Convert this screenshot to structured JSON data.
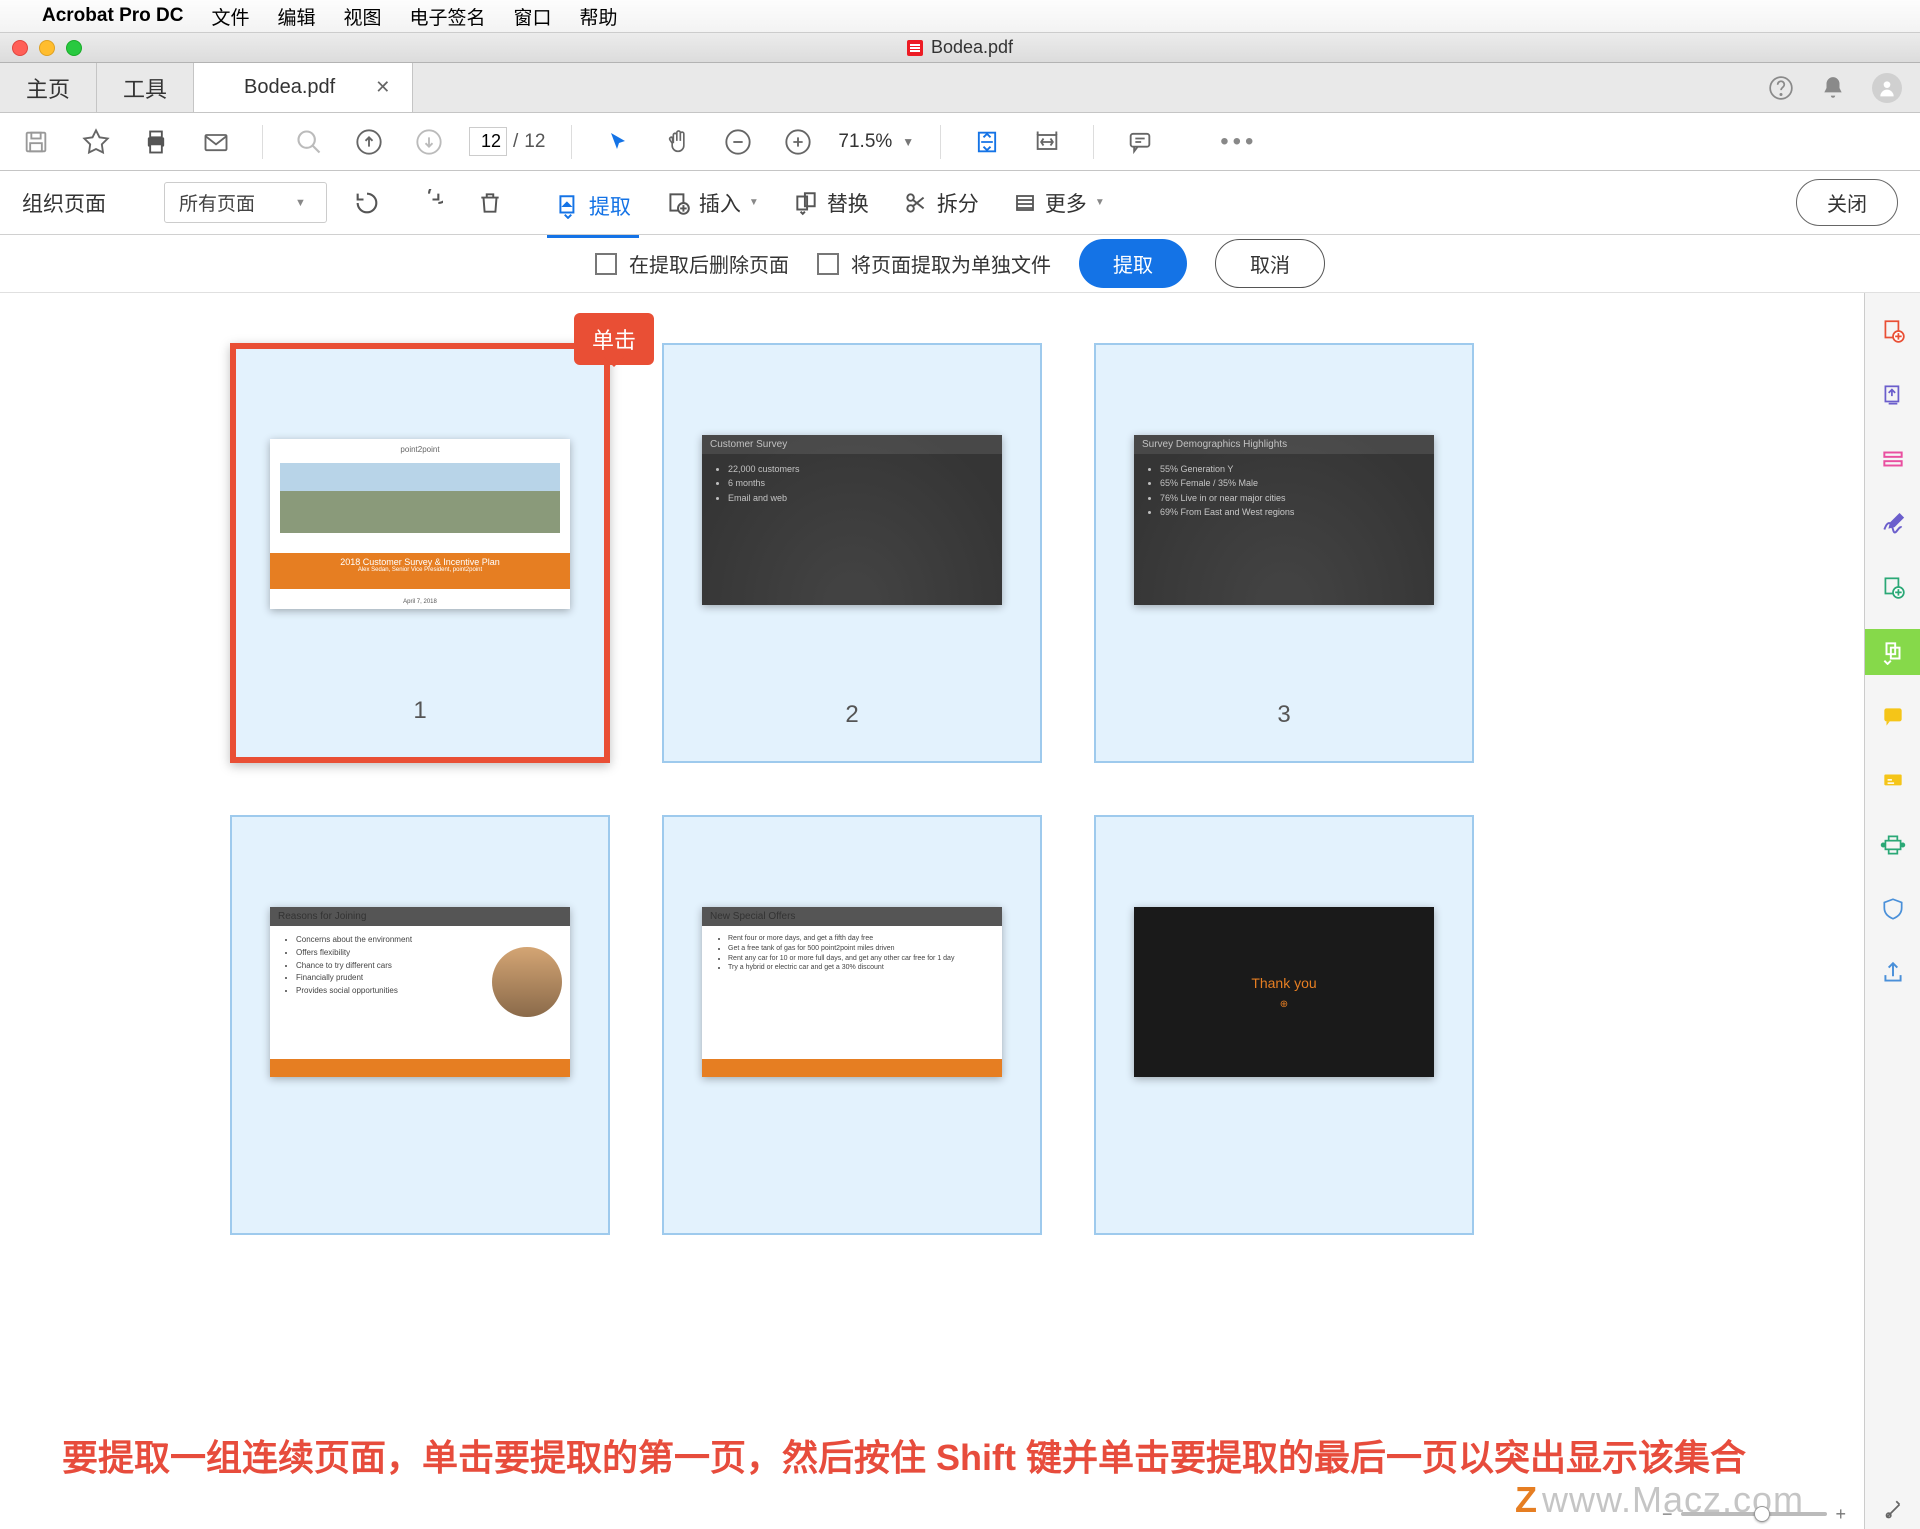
{
  "menubar": {
    "app": "Acrobat Pro DC",
    "items": [
      "文件",
      "编辑",
      "视图",
      "电子签名",
      "窗口",
      "帮助"
    ]
  },
  "window": {
    "title": "Bodea.pdf"
  },
  "tabs": {
    "home": "主页",
    "tools": "工具",
    "active": "Bodea.pdf"
  },
  "toolbar": {
    "page_current": "12",
    "page_sep": "/",
    "page_total": "12",
    "zoom": "71.5%"
  },
  "orgbar": {
    "title": "组织页面",
    "pages_filter": "所有页面",
    "extract": "提取",
    "insert": "插入",
    "replace": "替换",
    "split": "拆分",
    "more": "更多",
    "close": "关闭"
  },
  "extractbar": {
    "delete_after": "在提取后删除页面",
    "as_separate": "将页面提取为单独文件",
    "extract": "提取",
    "cancel": "取消"
  },
  "callout": {
    "text": "单击"
  },
  "thumbs": {
    "pages": [
      "1",
      "2",
      "3"
    ],
    "slide1": {
      "logo": "point2point",
      "title": "2018 Customer Survey & Incentive Plan",
      "subtitle": "Alex Sedan, Senior Vice President, point2point",
      "date": "April 7, 2018"
    },
    "slide2": {
      "title": "Customer Survey",
      "items": [
        "22,000 customers",
        "6 months",
        "Email and web"
      ]
    },
    "slide3": {
      "title": "Survey Demographics Highlights",
      "items": [
        "55% Generation Y",
        "65% Female / 35% Male",
        "76% Live in or near major cities",
        "69% From East and West regions"
      ]
    },
    "slide4": {
      "title": "Reasons for Joining",
      "items": [
        "Concerns about the environment",
        "Offers flexibility",
        "Chance to try different cars",
        "Financially prudent",
        "Provides social opportunities"
      ]
    },
    "slide5": {
      "title": "New Special Offers",
      "items": [
        "Rent four or more days, and get a fifth day free",
        "Get a free tank of gas for 500 point2point miles driven",
        "Rent any car for 10 or more full days, and get any other car free for 1 day",
        "Try a hybrid or electric car and get a 30% discount"
      ]
    },
    "slide6": {
      "title": "Thank you"
    }
  },
  "instruction": {
    "text": "要提取一组连续页面，单击要提取的第一页，然后按住 Shift 键并单击要提取的最后一页以突出显示该集合"
  },
  "watermark": "www.Macz.com"
}
